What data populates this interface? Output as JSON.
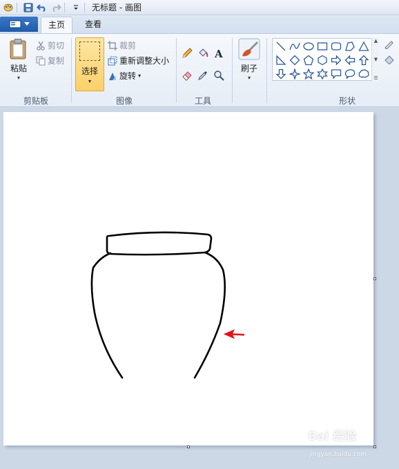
{
  "window": {
    "title": "无标题 - 画图"
  },
  "quick_access": {
    "icons": [
      "paint-app-icon",
      "save-icon",
      "undo-icon",
      "redo-icon",
      "customize-dropdown-icon"
    ]
  },
  "tabs": [
    {
      "label": "主页",
      "active": true
    },
    {
      "label": "查看",
      "active": false
    }
  ],
  "ribbon": {
    "clipboard": {
      "label": "剪贴板",
      "paste": "粘贴",
      "cut": "剪切",
      "copy": "复制"
    },
    "image": {
      "label": "图像",
      "select": "选择",
      "crop": "裁剪",
      "resize": "重新调整大小",
      "rotate": "旋转"
    },
    "tools": {
      "label": "工具",
      "items": [
        "pencil",
        "fill",
        "text",
        "eraser",
        "color-picker",
        "magnifier"
      ]
    },
    "brushes": {
      "label": "刷子"
    },
    "shapes": {
      "label": "形状"
    }
  },
  "canvas": {
    "drawing": "vase outline",
    "annotation_color": "#e0131b"
  },
  "watermark": {
    "text": "Bai 经验",
    "sub": "jingyan.baidu.com"
  },
  "colors": {
    "accent_blue": "#2a67b8",
    "select_highlight": "#fbd06a",
    "arrow_red": "#e0131b"
  }
}
